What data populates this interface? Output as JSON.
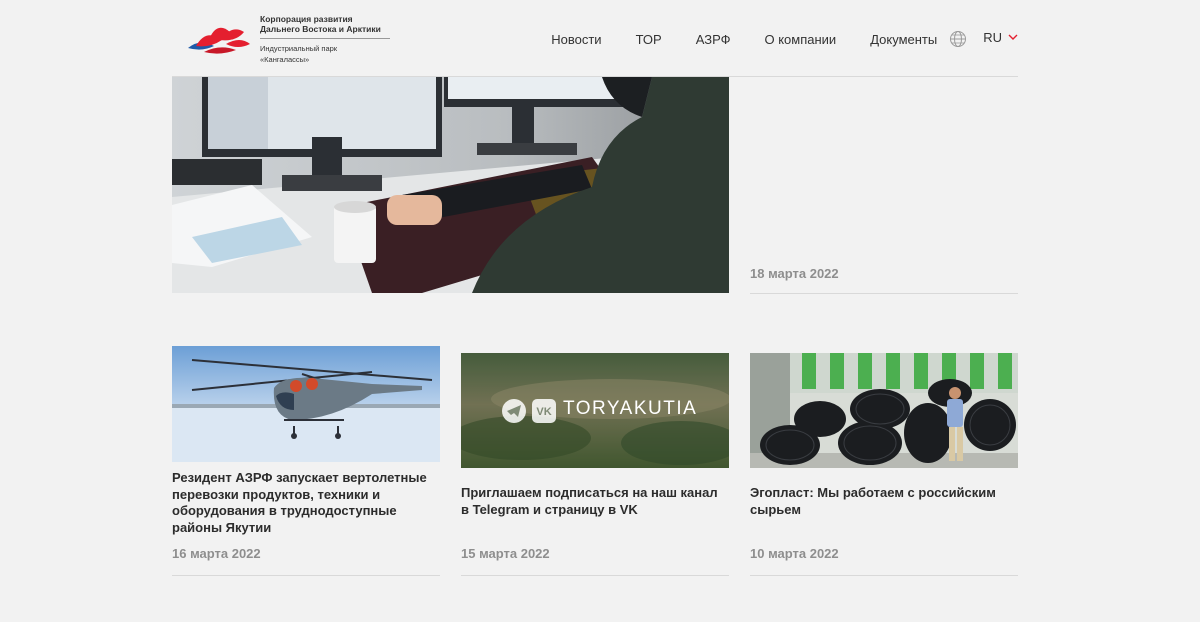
{
  "header": {
    "logo": {
      "corp_name": "Корпорация развития\nДальнего Востока и Арктики",
      "park_name": "Индустриальный парк\n«Кангалассы»"
    },
    "nav": [
      "Новости",
      "ТОР",
      "АЗРФ",
      "О компании",
      "Документы"
    ],
    "language": "RU",
    "colors": {
      "accent": "#e41f2f",
      "logo_blue": "#1f5aa8"
    }
  },
  "featured": {
    "image": "person-at-computer-workstation",
    "date": "18 марта 2022"
  },
  "news": [
    {
      "image": "helicopter-on-snowfield",
      "title": "Резидент АЗРФ запускает вертолетные перевозки продуктов, техники и оборудования в труднодоступные районы Якутии",
      "date": "16 марта 2022"
    },
    {
      "image": "toryakutia-social-banner",
      "image_text": "TORYAKUTIA",
      "title": "Приглашаем подписаться на наш канал в Telegram и страницу в VK",
      "date": "15 марта 2022"
    },
    {
      "image": "pipe-coils-warehouse",
      "title": "Эгопласт: Мы работаем с российским сырьем",
      "date": "10 марта 2022"
    }
  ]
}
